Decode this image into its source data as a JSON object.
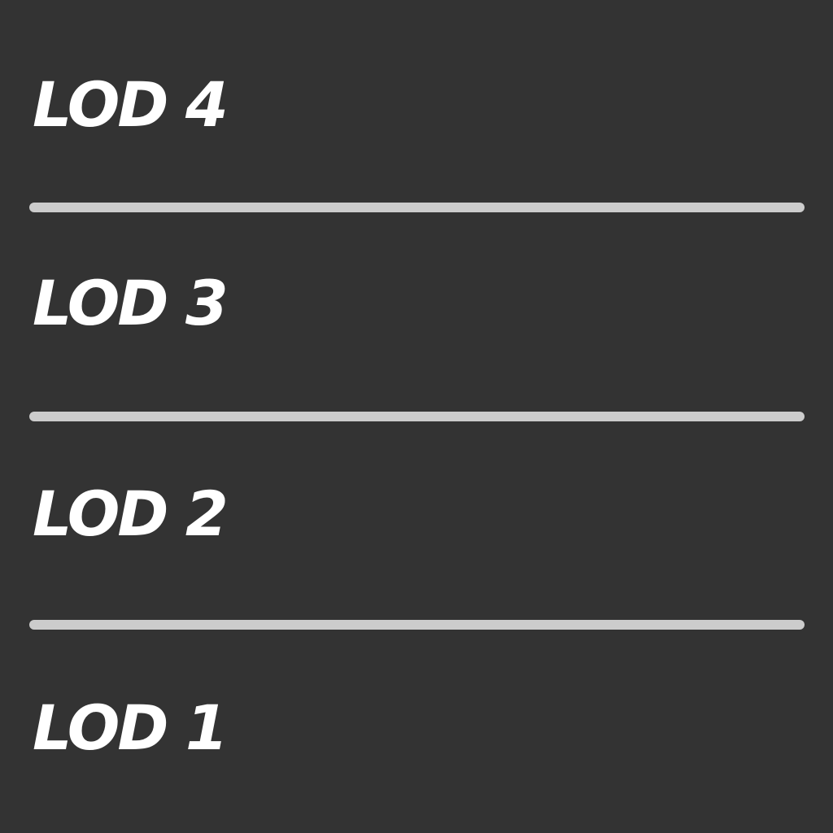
{
  "levels": [
    {
      "label": "LOD 4"
    },
    {
      "label": "LOD 3"
    },
    {
      "label": "LOD 2"
    },
    {
      "label": "LOD 1"
    }
  ],
  "colors": {
    "background": "#333333",
    "text": "#ffffff",
    "divider": "#cccccc"
  }
}
